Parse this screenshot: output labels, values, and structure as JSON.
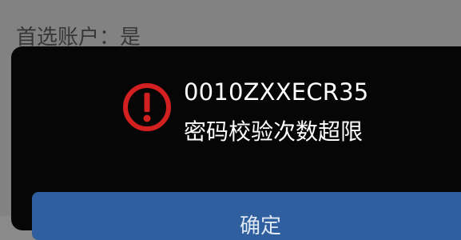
{
  "background": {
    "preferred_account_line": "首选账户：是"
  },
  "dialog": {
    "icon": "alert-circle-icon",
    "error_code": "0010ZXXECR35",
    "error_message": "密码校验次数超限",
    "confirm_label": "确定"
  },
  "colors": {
    "dialog_bg": "#060606",
    "icon_red": "#d21f1f",
    "button_blue": "#2f5f9f",
    "page_bg": "#8a8a8a"
  }
}
